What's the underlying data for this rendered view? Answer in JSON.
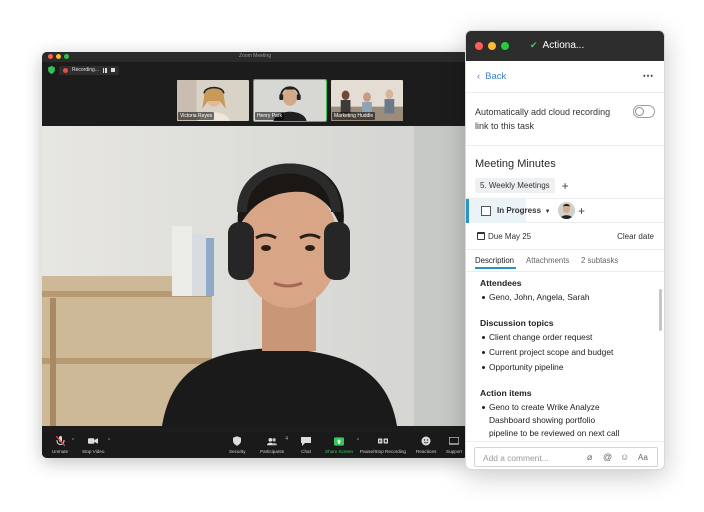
{
  "zoom": {
    "window_title": "Zoom Meeting",
    "recording_label": "Recording...",
    "participants_thumbs": [
      {
        "name": "Victoria Reyes"
      },
      {
        "name": "Henry Park"
      },
      {
        "name": "Marketing Huddle"
      }
    ],
    "toolbar": {
      "unmute": "Unmute",
      "stop_video": "Stop Video",
      "security": "Security",
      "participants": "Participants",
      "participants_count": "4",
      "chat": "Chat",
      "share_screen": "Share Screen",
      "pause_stop_recording": "Pause/Stop Recording",
      "reactions": "Reactions",
      "support": "Support"
    },
    "colors": {
      "active_green": "#33c25a",
      "record_red": "#e84a4a"
    }
  },
  "wrike": {
    "window_title": "Actiona...",
    "back_label": "Back",
    "more_icon": "⋯",
    "auto_recording_text": "Automatically add cloud recording link to this task",
    "auto_recording_enabled": false,
    "task_title": "Meeting Minutes",
    "folder_tag": "5. Weekly Meetings",
    "status": "In Progress",
    "due_date": "Due May 25",
    "clear_date": "Clear date",
    "tabs": [
      "Description",
      "Attachments",
      "2 subtasks"
    ],
    "description": {
      "attendees_heading": "Attendees",
      "attendees": "Geno, John, Angela, Sarah",
      "discussion_heading": "Discussion topics",
      "discussion_items": [
        "Client change order request",
        "Current project scope and budget",
        "Opportunity pipeline"
      ],
      "action_heading": "Action items",
      "action_item_lines": [
        "Geno to create Wrike Analyze",
        "Dashboard showing portfolio",
        "pipeline to be reviewed on next call"
      ]
    },
    "comment_placeholder": "Add a comment...",
    "comment_tools": {
      "attach": "⌀",
      "mention": "@",
      "emoji": "☺",
      "format": "Aa"
    },
    "colors": {
      "accent_blue": "#2a93c6",
      "link_blue": "#3b7fd4"
    }
  }
}
